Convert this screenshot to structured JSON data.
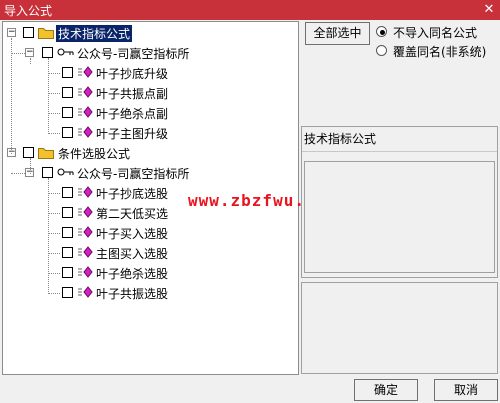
{
  "window": {
    "title": "导入公式",
    "close_glyph": "✕"
  },
  "buttons": {
    "select_all": "全部选中",
    "ok": "确定",
    "cancel": "取消"
  },
  "import_options": [
    {
      "label": "不导入同名公式",
      "selected": true
    },
    {
      "label": "覆盖同名(非系统)",
      "selected": false
    }
  ],
  "info_panel": {
    "heading": "技术指标公式"
  },
  "watermark": "www.zbzfwu.com",
  "tree": [
    {
      "label": "技术指标公式",
      "type": "folder",
      "expander": "−",
      "children": [
        {
          "label": "公众号-司赢空指标所",
          "type": "key",
          "expander": "−",
          "children": [
            "叶子抄底升级",
            "叶子共振点副",
            "叶子绝杀点副",
            "叶子主图升级"
          ]
        }
      ]
    },
    {
      "label": "条件选股公式",
      "type": "folder",
      "expander": "−",
      "children": [
        {
          "label": "公众号-司赢空指标所",
          "type": "key",
          "expander": "−",
          "children": [
            "叶子抄底选股",
            "第二天低买选",
            "叶子买入选股",
            "主图买入选股",
            "叶子绝杀选股",
            "叶子共振选股"
          ]
        }
      ]
    }
  ],
  "colors": {
    "titlebar": "#c8303a",
    "selection": "#0a246a",
    "folder": "#f2c12e",
    "formula_icon": "#d020c0",
    "watermark": "#e8141f"
  }
}
